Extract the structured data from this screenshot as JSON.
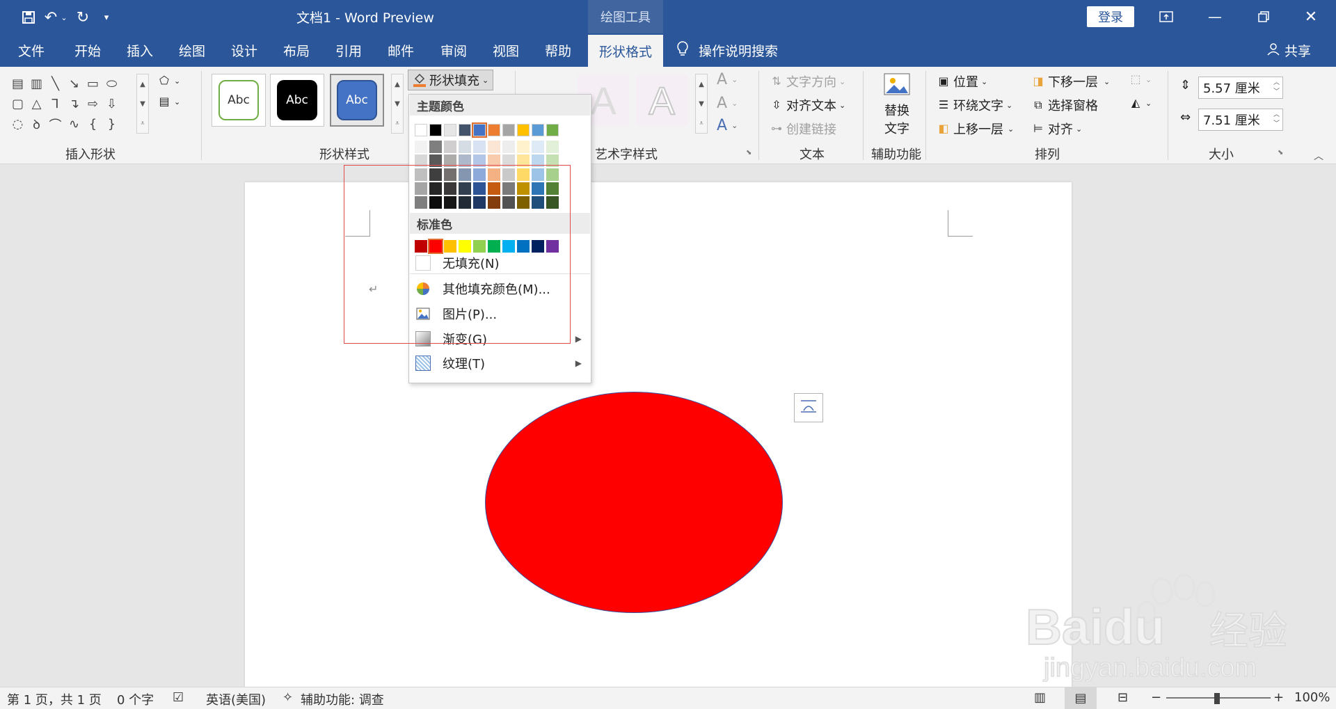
{
  "titlebar": {
    "doc_title": "文档1  -  Word Preview",
    "context_tab": "绘图工具",
    "login": "登录"
  },
  "tabs": [
    "文件",
    "开始",
    "插入",
    "绘图",
    "设计",
    "布局",
    "引用",
    "邮件",
    "审阅",
    "视图",
    "帮助",
    "形状格式"
  ],
  "tell_me": "操作说明搜索",
  "share": "共享",
  "ribbon": {
    "groups": {
      "insert_shapes": "插入形状",
      "shape_styles": "形状样式",
      "wordart_styles": "艺术字样式",
      "text": "文本",
      "accessibility": "辅助功能",
      "arrange": "排列",
      "size": "大小"
    },
    "style_sample": "Abc",
    "shape_fill_btn": "形状填充",
    "text_direction": "文字方向",
    "align_text": "对齐文本",
    "create_link": "创建链接",
    "alt_text_line1": "替换",
    "alt_text_line2": "文字",
    "position": "位置",
    "wrap_text": "环绕文字",
    "bring_forward": "上移一层",
    "send_backward": "下移一层",
    "selection_pane": "选择窗格",
    "align": "对齐",
    "height": "5.57 厘米",
    "width": "7.51 厘米",
    "wordart_letter": "A"
  },
  "fill_dropdown": {
    "theme_colors_header": "主题颜色",
    "standard_colors_header": "标准色",
    "no_fill": "无填充(N)",
    "more_colors": "其他填充颜色(M)...",
    "picture": "图片(P)...",
    "gradient": "渐变(G)",
    "texture": "纹理(T)",
    "theme_top_row": [
      "#ffffff",
      "#000000",
      "#e7e6e6",
      "#44546a",
      "#4472c4",
      "#ed7d31",
      "#a5a5a5",
      "#ffc000",
      "#5b9bd5",
      "#70ad47"
    ],
    "theme_shades": [
      [
        "#f2f2f2",
        "#7f7f7f",
        "#d0cece",
        "#d6dce4",
        "#d9e2f3",
        "#fbe5d5",
        "#ededed",
        "#fff2cc",
        "#deebf6",
        "#e2efd9"
      ],
      [
        "#d8d8d8",
        "#595959",
        "#aeabab",
        "#adb9ca",
        "#b4c6e7",
        "#f7cbac",
        "#dbdbdb",
        "#fee599",
        "#bdd7ee",
        "#c5e0b3"
      ],
      [
        "#bfbfbf",
        "#3f3f3f",
        "#757070",
        "#8496b0",
        "#8eaadb",
        "#f4b183",
        "#c9c9c9",
        "#ffd965",
        "#9dc3e6",
        "#a8d08d"
      ],
      [
        "#a5a5a5",
        "#262626",
        "#3a3838",
        "#323f4f",
        "#2f5496",
        "#c55a11",
        "#7b7b7b",
        "#bf9000",
        "#2e75b5",
        "#538135"
      ],
      [
        "#7f7f7f",
        "#0c0c0c",
        "#171616",
        "#222a35",
        "#1f3864",
        "#833c0b",
        "#525252",
        "#7f6000",
        "#1e4e79",
        "#375623"
      ]
    ],
    "standard": [
      "#c00000",
      "#ff0000",
      "#ffc000",
      "#ffff00",
      "#92d050",
      "#00b050",
      "#00b0f0",
      "#0070c0",
      "#002060",
      "#7030a0"
    ]
  },
  "shape": {
    "fill": "#ff0000",
    "outline": "#3a4fa0"
  },
  "statusbar": {
    "page": "第 1 页，共 1 页",
    "words": "0 个字",
    "language": "英语(美国)",
    "accessibility": "辅助功能: 调查",
    "zoom": "100%"
  },
  "watermark": {
    "brand": "Baidu",
    "brand_cn": "经验",
    "url": "jingyan.baidu.com"
  }
}
